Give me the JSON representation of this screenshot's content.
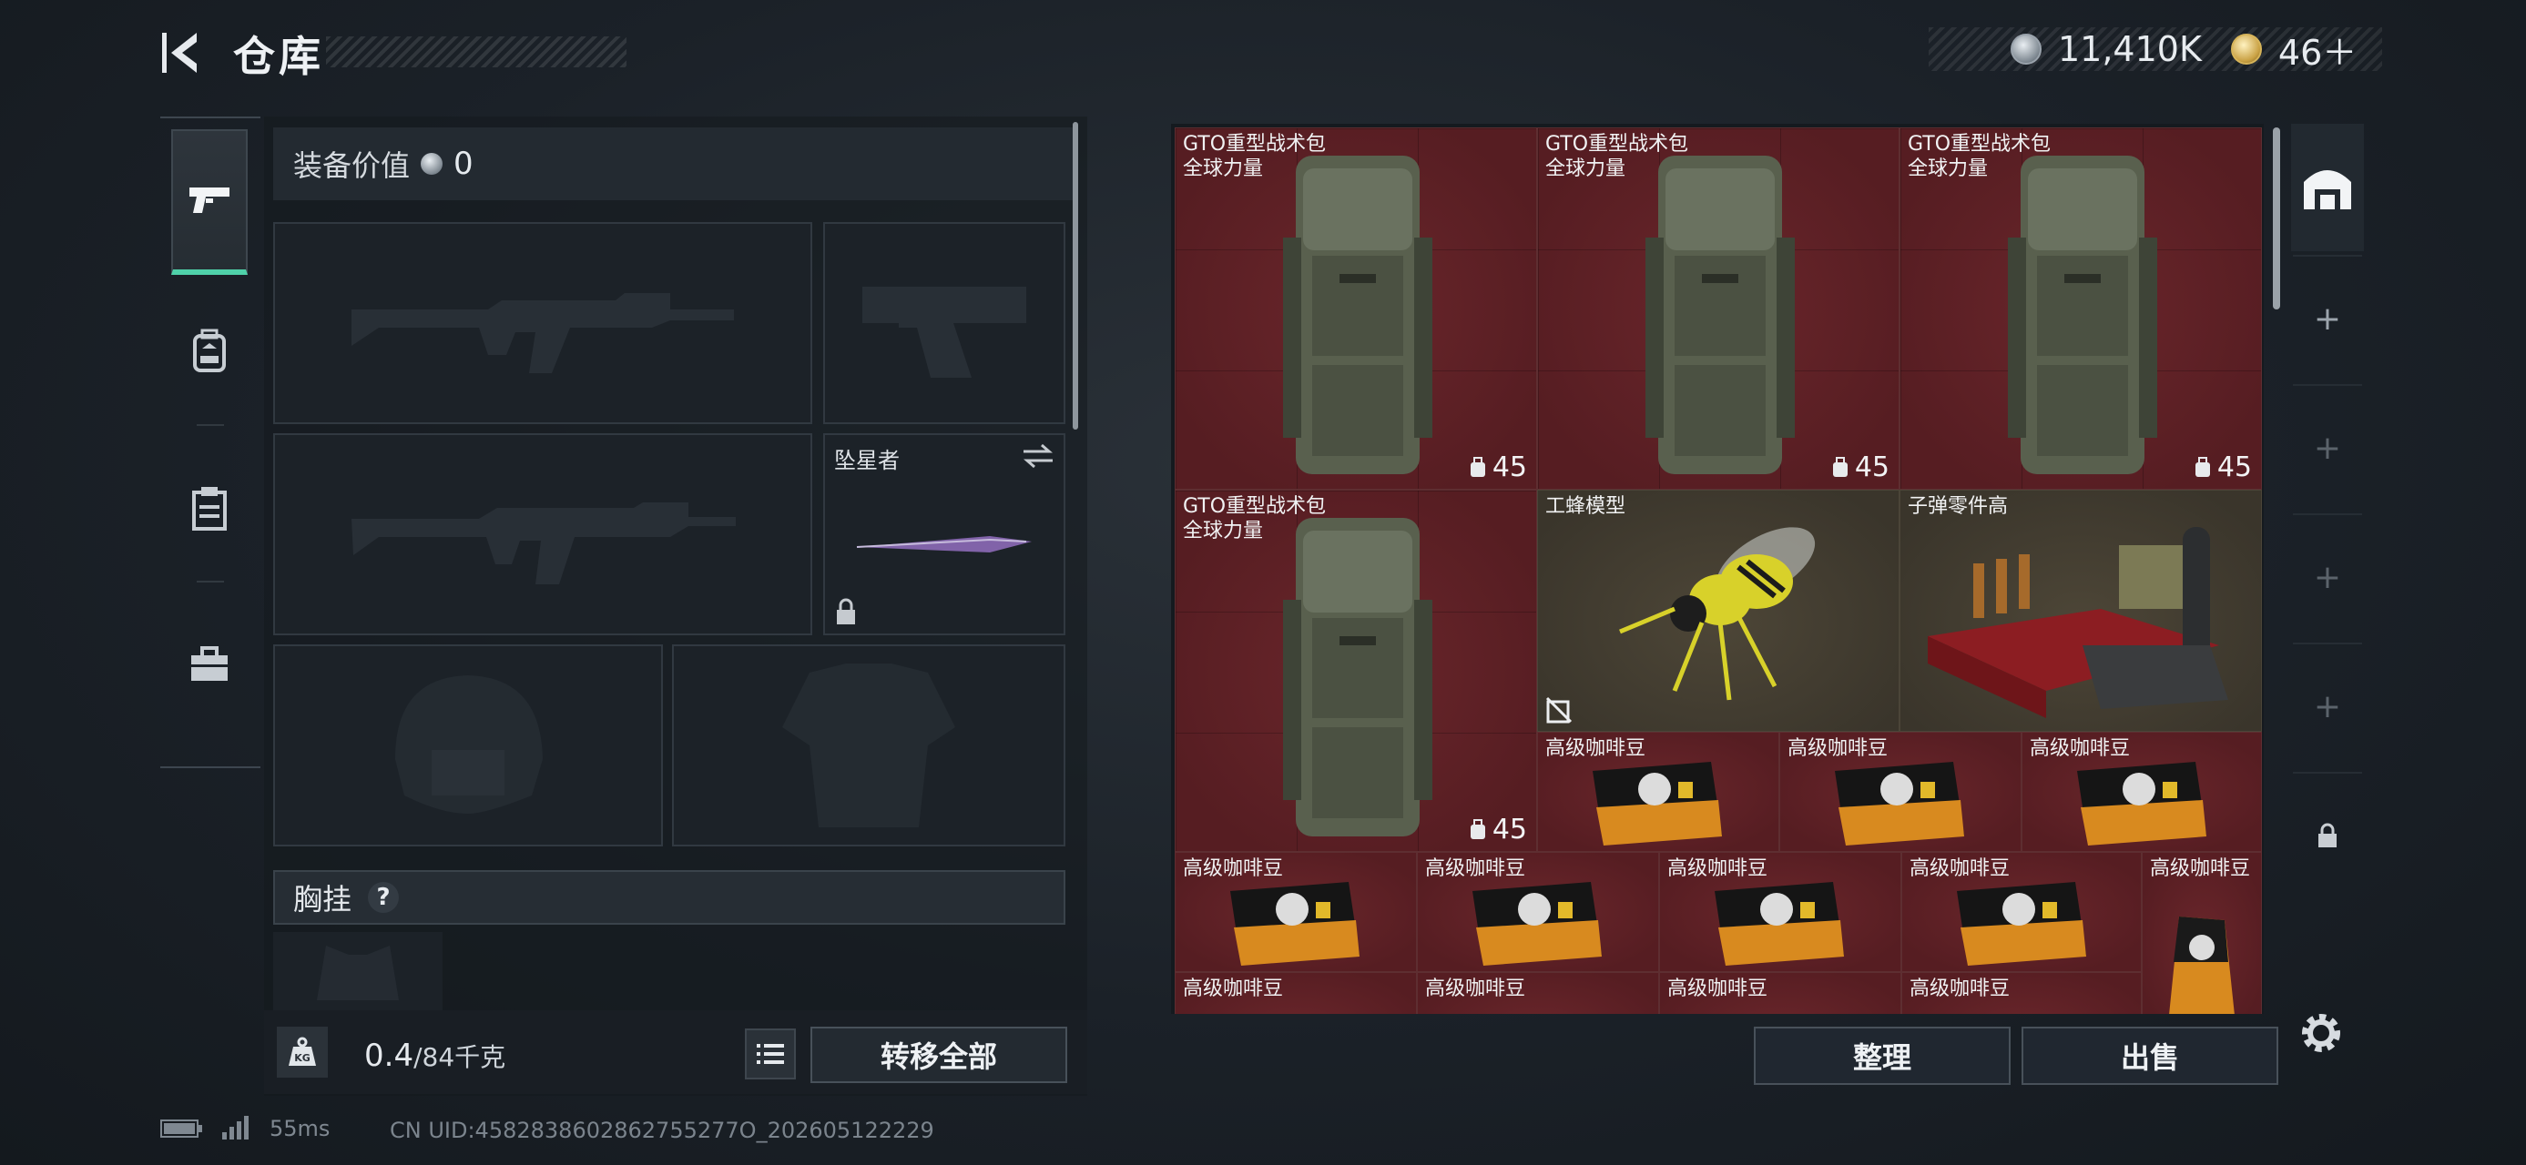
{
  "header": {
    "title": "仓库",
    "currency_coin": "11,410K",
    "currency_gold": "46＋"
  },
  "loadout": {
    "equip_value_label": "装备价值",
    "equip_value": "0",
    "knife_slot_label": "坠星者",
    "chest_label": "胸挂",
    "chest_help": "?",
    "weight_current": "0.4",
    "weight_max": "/84千克",
    "transfer_all": "转移全部"
  },
  "nav": {
    "icons": [
      "pistol-icon",
      "backpack-icon",
      "clipboard-icon",
      "toolbox-icon"
    ]
  },
  "storage": {
    "items": [
      {
        "name": "GTO重型战术包",
        "sub": "全球力量",
        "count": "45"
      },
      {
        "name": "GTO重型战术包",
        "sub": "全球力量",
        "count": "45"
      },
      {
        "name": "GTO重型战术包",
        "sub": "全球力量",
        "count": "45"
      },
      {
        "name": "GTO重型战术包",
        "sub": "全球力量",
        "count": "45"
      },
      {
        "name": "工蜂模型"
      },
      {
        "name": "子弹零件高"
      },
      {
        "name": "高级咖啡豆"
      },
      {
        "name": "高级咖啡豆"
      },
      {
        "name": "高级咖啡豆"
      },
      {
        "name": "高级咖啡豆"
      },
      {
        "name": "高级咖啡豆"
      },
      {
        "name": "高级咖啡豆"
      },
      {
        "name": "高级咖啡豆"
      },
      {
        "name": "高级咖啡豆"
      },
      {
        "name": "高级咖啡豆"
      },
      {
        "name": "高级咖啡豆"
      },
      {
        "name": "高级咖啡豆"
      },
      {
        "name": "高级咖啡豆"
      }
    ],
    "sort_label": "整理",
    "sell_label": "出售"
  },
  "footer": {
    "ping": "55ms",
    "uid": "CN UID:4582838602862755277O_202605122229"
  },
  "colors": {
    "accent": "#4fd1a9",
    "item_bg": "#5a1f24"
  }
}
